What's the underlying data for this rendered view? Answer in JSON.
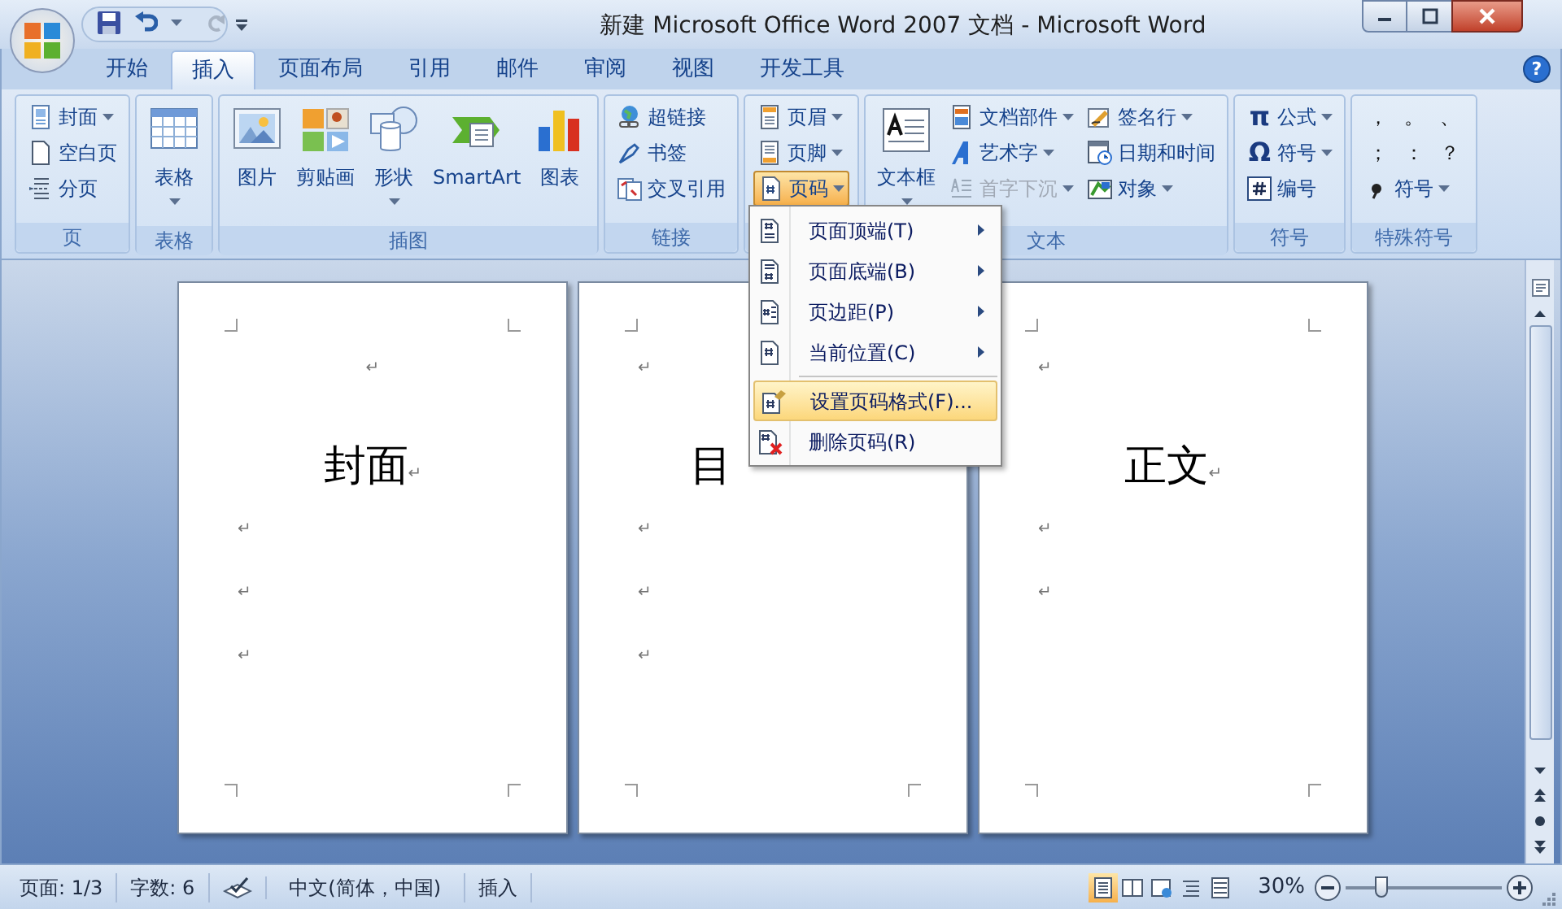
{
  "window": {
    "title": "新建 Microsoft Office Word 2007 文档 - Microsoft Word",
    "help": "?"
  },
  "tabs": [
    {
      "label": "开始",
      "selected": false
    },
    {
      "label": "插入",
      "selected": true
    },
    {
      "label": "页面布局",
      "selected": false
    },
    {
      "label": "引用",
      "selected": false
    },
    {
      "label": "邮件",
      "selected": false
    },
    {
      "label": "审阅",
      "selected": false
    },
    {
      "label": "视图",
      "selected": false
    },
    {
      "label": "开发工具",
      "selected": false
    }
  ],
  "ribbon": {
    "groups": [
      {
        "label": "页",
        "items": [
          {
            "kind": "small",
            "label": "封面",
            "dropdown": true
          },
          {
            "kind": "small",
            "label": "空白页",
            "dropdown": false
          },
          {
            "kind": "small",
            "label": "分页",
            "dropdown": false
          }
        ]
      },
      {
        "label": "表格",
        "items": [
          {
            "kind": "large",
            "label": "表格",
            "dropdown": true
          }
        ]
      },
      {
        "label": "插图",
        "items": [
          {
            "kind": "large",
            "label": "图片",
            "dropdown": false
          },
          {
            "kind": "large",
            "label": "剪贴画",
            "dropdown": false
          },
          {
            "kind": "large",
            "label": "形状",
            "dropdown": true
          },
          {
            "kind": "large",
            "label": "SmartArt",
            "dropdown": false
          },
          {
            "kind": "large",
            "label": "图表",
            "dropdown": false
          }
        ]
      },
      {
        "label": "链接",
        "items": [
          {
            "kind": "small",
            "label": "超链接",
            "dropdown": false
          },
          {
            "kind": "small",
            "label": "书签",
            "dropdown": false
          },
          {
            "kind": "small",
            "label": "交叉引用",
            "dropdown": false
          }
        ]
      },
      {
        "items": [
          {
            "kind": "small",
            "label": "页眉",
            "dropdown": true,
            "pressed": false
          },
          {
            "kind": "small",
            "label": "页脚",
            "dropdown": true,
            "pressed": false
          },
          {
            "kind": "small",
            "label": "页码",
            "dropdown": true,
            "pressed": true
          }
        ]
      },
      {
        "label": "文本",
        "items": [
          {
            "kind": "large",
            "label": "文本框",
            "dropdown": true,
            "disabled": false
          },
          {
            "kind": "small",
            "label": "文档部件",
            "dropdown": true,
            "disabled": false
          },
          {
            "kind": "small",
            "label": "艺术字",
            "dropdown": true,
            "disabled": false
          },
          {
            "kind": "small",
            "label": "首字下沉",
            "dropdown": true,
            "disabled": true
          },
          {
            "kind": "small",
            "label": "签名行",
            "dropdown": true,
            "disabled": false
          },
          {
            "kind": "small",
            "label": "日期和时间",
            "dropdown": false,
            "disabled": false
          },
          {
            "kind": "small",
            "label": "对象",
            "dropdown": true,
            "disabled": false
          }
        ]
      },
      {
        "label": "符号",
        "items": [
          {
            "kind": "small",
            "label": "公式",
            "dropdown": true,
            "glyph": "π"
          },
          {
            "kind": "small",
            "label": "符号",
            "dropdown": true,
            "glyph": "Ω"
          },
          {
            "kind": "small",
            "label": "编号",
            "dropdown": false
          }
        ]
      },
      {
        "label": "特殊符号",
        "items": [
          {
            "kind": "symbol",
            "label": "，"
          },
          {
            "kind": "symbol",
            "label": "。"
          },
          {
            "kind": "symbol",
            "label": "、"
          },
          {
            "kind": "symbol",
            "label": "；"
          },
          {
            "kind": "symbol",
            "label": "："
          },
          {
            "kind": "symbol",
            "label": "？"
          },
          {
            "kind": "small",
            "label": "符号",
            "dropdown": true
          }
        ]
      }
    ]
  },
  "menu": {
    "items": [
      {
        "kind": "item",
        "label": "页面顶端(T)",
        "submenu": true,
        "selected": false
      },
      {
        "kind": "item",
        "label": "页面底端(B)",
        "submenu": true,
        "selected": false
      },
      {
        "kind": "item",
        "label": "页边距(P)",
        "submenu": true,
        "selected": false
      },
      {
        "kind": "item",
        "label": "当前位置(C)",
        "submenu": true,
        "selected": false
      },
      {
        "kind": "separator"
      },
      {
        "kind": "item",
        "label": "设置页码格式(F)...",
        "submenu": false,
        "selected": true
      },
      {
        "kind": "item",
        "label": "删除页码(R)",
        "submenu": false,
        "selected": false
      }
    ]
  },
  "pages": [
    {
      "paragraphs": [
        {
          "kind": "centered-blank",
          "mark": "↵"
        },
        {
          "kind": "heading",
          "text": "封面",
          "mark": "↵"
        },
        {
          "kind": "blank",
          "mark": "↵"
        },
        {
          "kind": "blank",
          "mark": "↵"
        },
        {
          "kind": "blank",
          "mark": "↵"
        }
      ]
    },
    {
      "paragraphs": [
        {
          "kind": "blank",
          "mark": "↵"
        },
        {
          "kind": "cut-heading",
          "text": "目"
        },
        {
          "kind": "blank",
          "mark": "↵"
        },
        {
          "kind": "blank",
          "mark": "↵"
        },
        {
          "kind": "blank",
          "mark": "↵"
        }
      ]
    },
    {
      "paragraphs": [
        {
          "kind": "blank",
          "mark": "↵"
        },
        {
          "kind": "heading",
          "text": "正文",
          "mark": "↵"
        },
        {
          "kind": "blank",
          "mark": "↵"
        },
        {
          "kind": "blank",
          "mark": "↵"
        }
      ]
    }
  ],
  "status_bar": {
    "page": "页面: 1/3",
    "words": "字数: 6",
    "language": "中文(简体，中国)",
    "mode": "插入",
    "views": [
      {
        "selected": true
      },
      {
        "selected": false
      },
      {
        "selected": false
      },
      {
        "selected": false
      },
      {
        "selected": false
      }
    ],
    "zoom": {
      "reading": "30%",
      "level": 0.2
    }
  }
}
